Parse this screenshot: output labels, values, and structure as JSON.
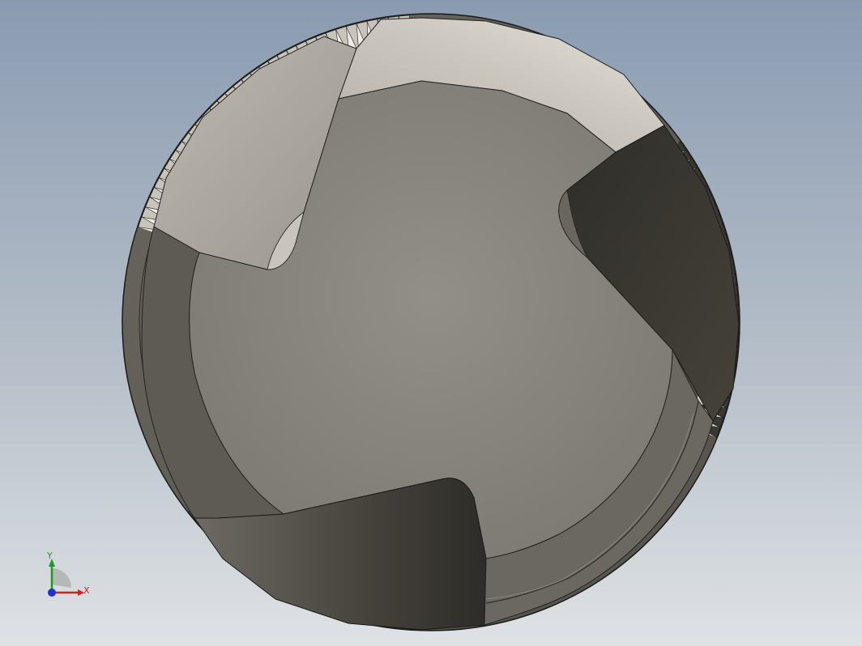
{
  "viewport": {
    "background_top": "#8a9bb1",
    "background_bottom": "#dfe2e5",
    "model": "cylindrical-cutter-end-view"
  },
  "part": {
    "body_color": "#8e8b84",
    "light_face_color": "#ddd8d0",
    "dark_face_color": "#36342f",
    "ring_color": "#5f5c56",
    "edge_color": "#1a1a1a"
  },
  "triad": {
    "x_label": "X",
    "y_label": "Y",
    "x_color": "#d22020",
    "y_color": "#1e9a2a",
    "z_color": "#2030c8",
    "icon": "coordinate-triad-icon"
  }
}
